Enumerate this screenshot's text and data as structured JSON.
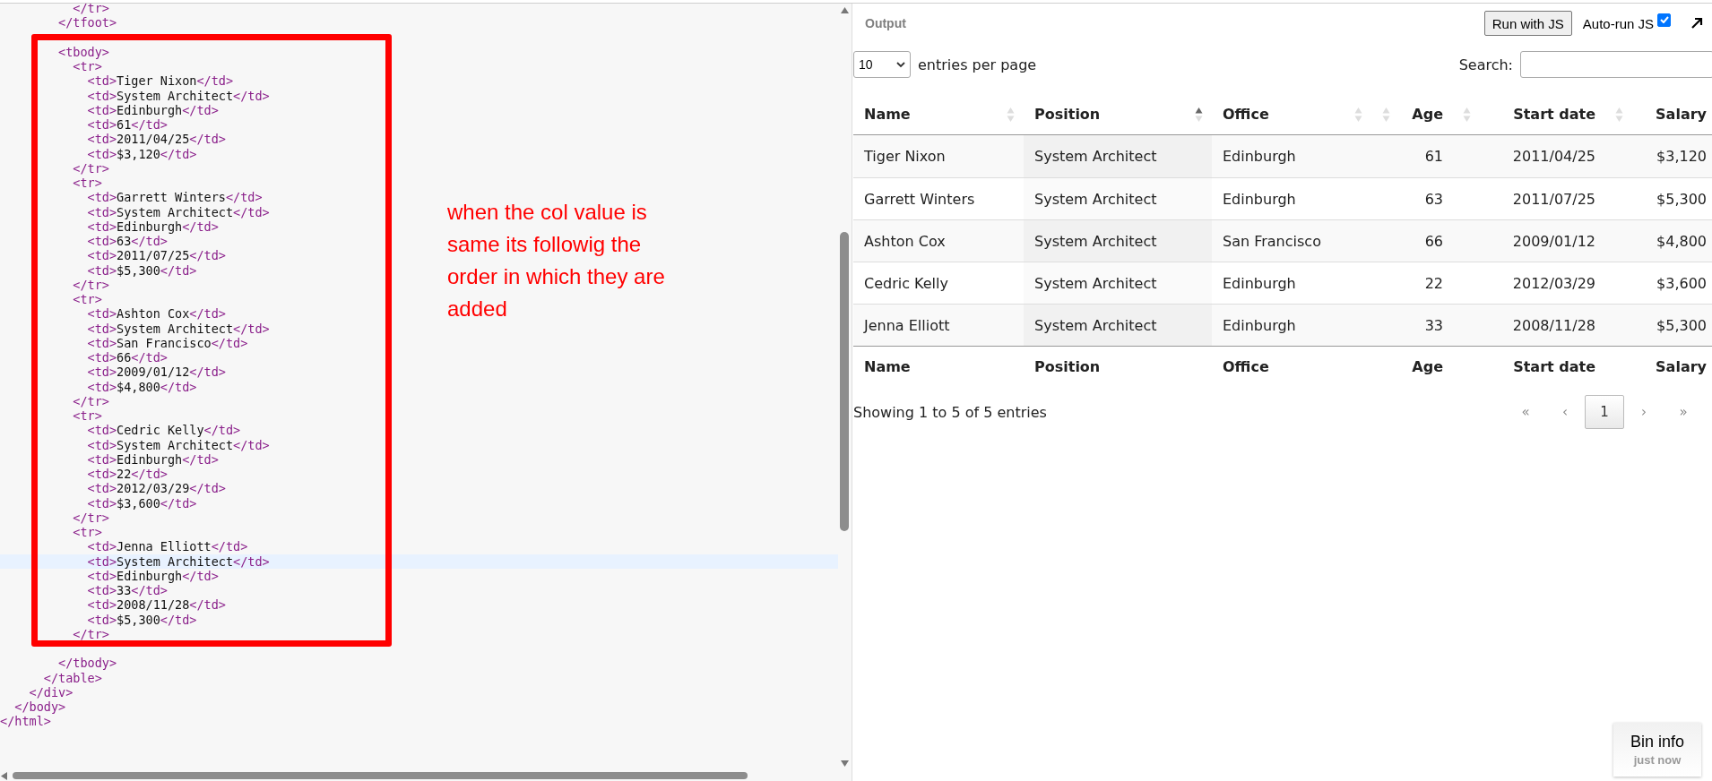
{
  "editor": {
    "lines": [
      {
        "kind": "code",
        "text": "          </tr>",
        "current": false
      },
      {
        "kind": "code",
        "text": "        </tfoot>",
        "current": false
      },
      {
        "kind": "blank",
        "current": false
      },
      {
        "kind": "code",
        "text": "        <tbody>",
        "current": false
      },
      {
        "kind": "code",
        "text": "          <tr>",
        "current": false
      },
      {
        "kind": "code",
        "text": "            <td>Tiger Nixon</td>",
        "current": false
      },
      {
        "kind": "code",
        "text": "            <td>System Architect</td>",
        "current": false
      },
      {
        "kind": "code",
        "text": "            <td>Edinburgh</td>",
        "current": false
      },
      {
        "kind": "code",
        "text": "            <td>61</td>",
        "current": false
      },
      {
        "kind": "code",
        "text": "            <td>2011/04/25</td>",
        "current": false
      },
      {
        "kind": "code",
        "text": "            <td>$3,120</td>",
        "current": false
      },
      {
        "kind": "code",
        "text": "          </tr>",
        "current": false
      },
      {
        "kind": "code",
        "text": "          <tr>",
        "current": false
      },
      {
        "kind": "code",
        "text": "            <td>Garrett Winters</td>",
        "current": false
      },
      {
        "kind": "code",
        "text": "            <td>System Architect</td>",
        "current": false
      },
      {
        "kind": "code",
        "text": "            <td>Edinburgh</td>",
        "current": false
      },
      {
        "kind": "code",
        "text": "            <td>63</td>",
        "current": false
      },
      {
        "kind": "code",
        "text": "            <td>2011/07/25</td>",
        "current": false
      },
      {
        "kind": "code",
        "text": "            <td>$5,300</td>",
        "current": false
      },
      {
        "kind": "code",
        "text": "          </tr>",
        "current": false
      },
      {
        "kind": "code",
        "text": "          <tr>",
        "current": false
      },
      {
        "kind": "code",
        "text": "            <td>Ashton Cox</td>",
        "current": false
      },
      {
        "kind": "code",
        "text": "            <td>System Architect</td>",
        "current": false
      },
      {
        "kind": "code",
        "text": "            <td>San Francisco</td>",
        "current": false
      },
      {
        "kind": "code",
        "text": "            <td>66</td>",
        "current": false
      },
      {
        "kind": "code",
        "text": "            <td>2009/01/12</td>",
        "current": false
      },
      {
        "kind": "code",
        "text": "            <td>$4,800</td>",
        "current": false
      },
      {
        "kind": "code",
        "text": "          </tr>",
        "current": false
      },
      {
        "kind": "code",
        "text": "          <tr>",
        "current": false
      },
      {
        "kind": "code",
        "text": "            <td>Cedric Kelly</td>",
        "current": false
      },
      {
        "kind": "code",
        "text": "            <td>System Architect</td>",
        "current": false
      },
      {
        "kind": "code",
        "text": "            <td>Edinburgh</td>",
        "current": false
      },
      {
        "kind": "code",
        "text": "            <td>22</td>",
        "current": false
      },
      {
        "kind": "code",
        "text": "            <td>2012/03/29</td>",
        "current": false
      },
      {
        "kind": "code",
        "text": "            <td>$3,600</td>",
        "current": false
      },
      {
        "kind": "code",
        "text": "          </tr>",
        "current": false
      },
      {
        "kind": "code",
        "text": "          <tr>",
        "current": false
      },
      {
        "kind": "code",
        "text": "            <td>Jenna Elliott</td>",
        "current": false
      },
      {
        "kind": "code",
        "text": "            <td>System Architect</td>",
        "current": true
      },
      {
        "kind": "code",
        "text": "            <td>Edinburgh</td>",
        "current": false
      },
      {
        "kind": "code",
        "text": "            <td>33</td>",
        "current": false
      },
      {
        "kind": "code",
        "text": "            <td>2008/11/28</td>",
        "current": false
      },
      {
        "kind": "code",
        "text": "            <td>$5,300</td>",
        "current": false
      },
      {
        "kind": "code",
        "text": "          </tr>",
        "current": false
      },
      {
        "kind": "blank",
        "current": false
      },
      {
        "kind": "code",
        "text": "        </tbody>",
        "current": false
      },
      {
        "kind": "code",
        "text": "      </table>",
        "current": false
      },
      {
        "kind": "code",
        "text": "    </div>",
        "current": false
      },
      {
        "kind": "code",
        "text": "  </body>",
        "current": false
      },
      {
        "kind": "code",
        "text": "</html>",
        "current": false
      }
    ],
    "annotation": {
      "note": "when the col value is same its followig the order in which they are added",
      "color": "#ff0000"
    }
  },
  "output": {
    "title": "Output",
    "run_button": "Run with JS",
    "auto_run": {
      "label": "Auto-run JS",
      "checked": true
    },
    "length_select": {
      "value": "10",
      "label": "entries per page"
    },
    "search": {
      "label": "Search:"
    },
    "table": {
      "columns": [
        {
          "label": "Name",
          "kind": "text",
          "sorted": false
        },
        {
          "label": "Position",
          "kind": "text",
          "sorted": true
        },
        {
          "label": "Office",
          "kind": "text",
          "sorted": false
        },
        {
          "label": "Age",
          "kind": "num",
          "sorted": false
        },
        {
          "label": "Start date",
          "kind": "num",
          "sorted": false
        },
        {
          "label": "Salary",
          "kind": "num",
          "sorted": false
        }
      ],
      "rows": [
        [
          "Tiger Nixon",
          "System Architect",
          "Edinburgh",
          "61",
          "2011/04/25",
          "$3,120"
        ],
        [
          "Garrett Winters",
          "System Architect",
          "Edinburgh",
          "63",
          "2011/07/25",
          "$5,300"
        ],
        [
          "Ashton Cox",
          "System Architect",
          "San Francisco",
          "66",
          "2009/01/12",
          "$4,800"
        ],
        [
          "Cedric Kelly",
          "System Architect",
          "Edinburgh",
          "22",
          "2012/03/29",
          "$3,600"
        ],
        [
          "Jenna Elliott",
          "System Architect",
          "Edinburgh",
          "33",
          "2008/11/28",
          "$5,300"
        ]
      ],
      "footer": [
        "Name",
        "Position",
        "Office",
        "Age",
        "Start date",
        "Salary"
      ]
    },
    "info": "Showing 1 to 5 of 5 entries",
    "pagination": [
      {
        "label": "«",
        "selected": false,
        "disabled": true
      },
      {
        "label": "‹",
        "selected": false,
        "disabled": true
      },
      {
        "label": "1",
        "selected": true,
        "disabled": false
      },
      {
        "label": "›",
        "selected": false,
        "disabled": true
      },
      {
        "label": "»",
        "selected": false,
        "disabled": true
      }
    ]
  },
  "bin_info": {
    "title": "Bin info",
    "time": "just now"
  }
}
